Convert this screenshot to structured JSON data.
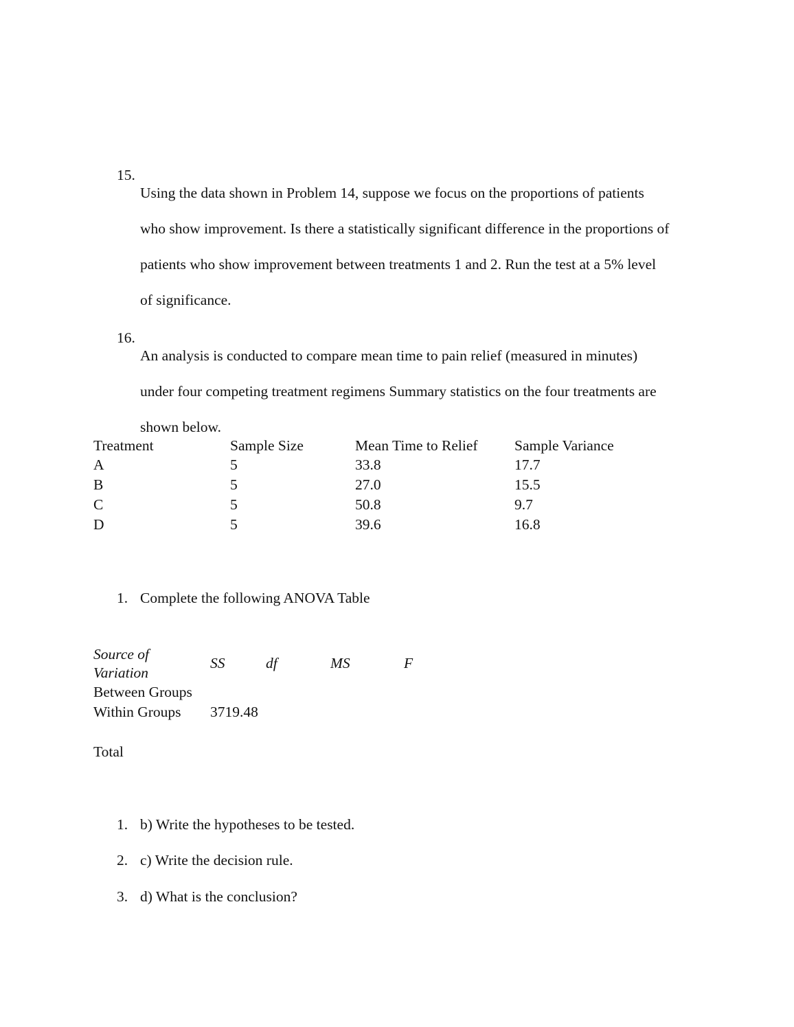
{
  "problem15": {
    "number": "15.",
    "lines": [
      "Using the data shown in Problem 14, suppose we focus on the proportions of patients",
      "who show improvement. Is there a statistically significant difference in the proportions of",
      "patients who show improvement between treatments 1 and 2.  Run the test at a 5% level",
      "of significance."
    ]
  },
  "problem16": {
    "number": "16.",
    "lines": [
      "An analysis is conducted to compare mean time to pain relief (measured in minutes)",
      "under four competing treatment regimens Summary statistics on the four treatments are",
      "shown below."
    ]
  },
  "summary_table": {
    "headers": [
      "Treatment",
      "Sample Size",
      "Mean Time to Relief",
      "Sample Variance"
    ],
    "rows": [
      [
        "A",
        "5",
        "33.8",
        "17.7"
      ],
      [
        "B",
        "5",
        "27.0",
        "15.5"
      ],
      [
        "C",
        "5",
        "50.8",
        "9.7"
      ],
      [
        "D",
        "5",
        "39.6",
        "16.8"
      ]
    ]
  },
  "part_a": {
    "number": "1.",
    "text": "Complete the following ANOVA Table"
  },
  "anova_table": {
    "header_source_line1": "Source of",
    "header_source_line2": "Variation",
    "headers": [
      "SS",
      "df",
      "MS",
      "F"
    ],
    "rows": [
      {
        "label": "Between Groups",
        "ss": ""
      },
      {
        "label": "Within Groups",
        "ss": "3719.48"
      },
      {
        "label": "Total",
        "ss": ""
      }
    ]
  },
  "questions": [
    {
      "number": "1.",
      "text": "b) Write the hypotheses to be tested."
    },
    {
      "number": "2.",
      "text": "c) Write the decision rule."
    },
    {
      "number": "3.",
      "text": "d) What is the conclusion?"
    }
  ]
}
